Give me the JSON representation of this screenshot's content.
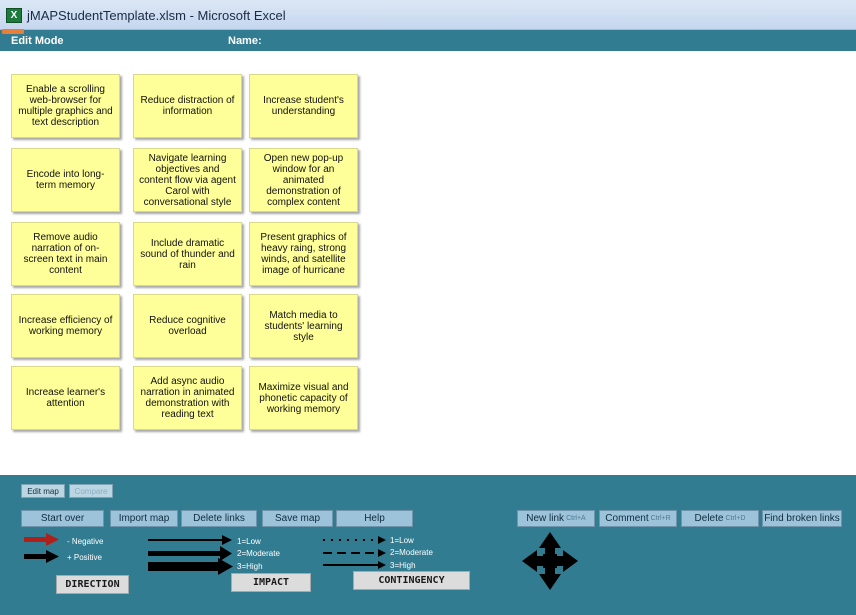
{
  "window": {
    "title": "jMAPStudentTemplate.xlsm - Microsoft Excel",
    "app_icon": "excel-icon",
    "app_icon_glyph": "X"
  },
  "header": {
    "edit_mode": "Edit Mode",
    "name_label": "Name:"
  },
  "notes": [
    "Enable a scrolling web-browser for multiple graphics and text description",
    "Reduce distraction of information",
    "Increase student's understanding",
    "Encode into long-term memory",
    "Navigate learning objectives and content flow via agent Carol with conversational style",
    "Open new pop-up window for an animated demonstration of complex content",
    "Remove audio narration of on-screen text in main content",
    "Include dramatic sound of thunder and rain",
    "Present graphics of heavy raing, strong winds, and satellite image of hurricane",
    "Increase efficiency of working memory",
    "Reduce cognitive overload",
    "Match media to students' learning style",
    "Increase learner's attention",
    "Add async audio narration in animated demonstration with reading text",
    "Maximize visual and phonetic capacity of working memory"
  ],
  "panel": {
    "edit_map": "Edit map",
    "compare": "Compare",
    "buttons": {
      "start_over": "Start over",
      "import_map": "Import map",
      "delete_links": "Delete links",
      "save_map": "Save map",
      "help": "Help",
      "new_link": "New link",
      "new_link_shortcut": "Ctrl+A",
      "comment": "Comment",
      "comment_shortcut": "Ctrl+R",
      "delete": "Delete",
      "delete_shortcut": "Ctrl+D",
      "find_broken": "Find broken links"
    },
    "legend": {
      "negative": "- Negative",
      "positive": "+ Positive",
      "direction": "DIRECTION",
      "impact_low": "1=Low",
      "impact_moderate": "2=Moderate",
      "impact_high": "3=High",
      "impact": "IMPACT",
      "cont_low": "1=Low",
      "cont_moderate": "2=Moderate",
      "cont_high": "3=High",
      "contingency": "CONTINGENCY"
    },
    "colors": {
      "negative": "#b0201a",
      "positive": "#000000"
    },
    "move_icon": "four-way-move-icon"
  }
}
